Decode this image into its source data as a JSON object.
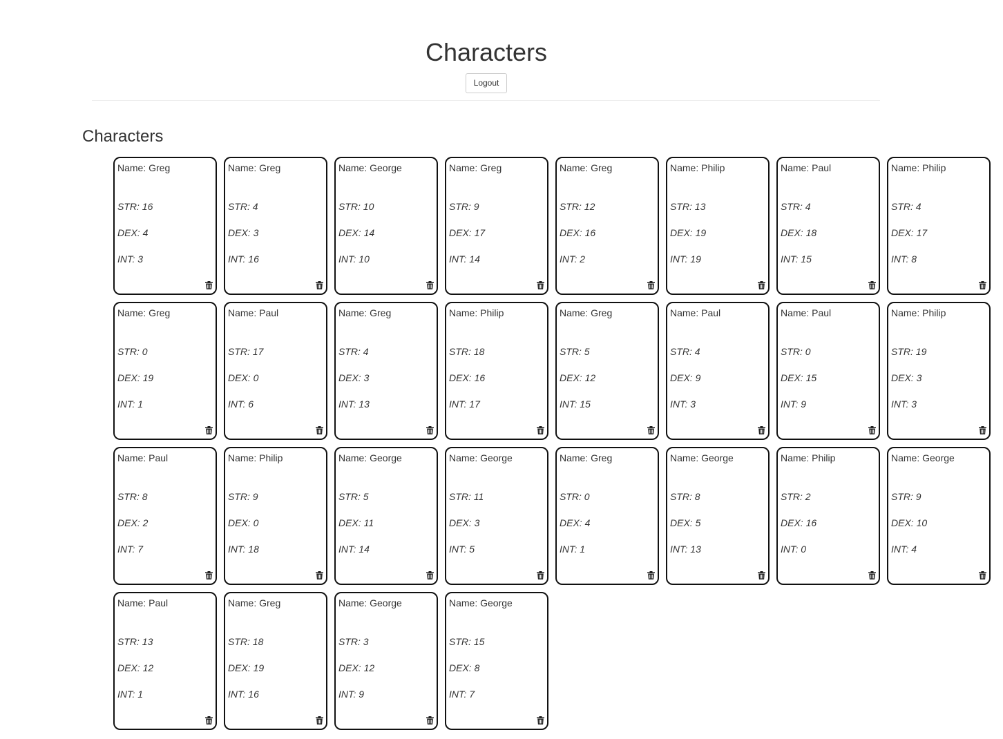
{
  "header": {
    "title": "Characters",
    "logout_label": "Logout"
  },
  "section": {
    "title": "Characters"
  },
  "labels": {
    "name": "Name: ",
    "str": "STR: ",
    "dex": "DEX: ",
    "int": "INT: "
  },
  "icons": {
    "delete": "trash-icon"
  },
  "characters": [
    {
      "name": "Greg",
      "str": 16,
      "dex": 4,
      "int": 3
    },
    {
      "name": "Greg",
      "str": 4,
      "dex": 3,
      "int": 16
    },
    {
      "name": "George",
      "str": 10,
      "dex": 14,
      "int": 10
    },
    {
      "name": "Greg",
      "str": 9,
      "dex": 17,
      "int": 14
    },
    {
      "name": "Greg",
      "str": 12,
      "dex": 16,
      "int": 2
    },
    {
      "name": "Philip",
      "str": 13,
      "dex": 19,
      "int": 19
    },
    {
      "name": "Paul",
      "str": 4,
      "dex": 18,
      "int": 15
    },
    {
      "name": "Philip",
      "str": 4,
      "dex": 17,
      "int": 8
    },
    {
      "name": "Greg",
      "str": 0,
      "dex": 19,
      "int": 1
    },
    {
      "name": "Paul",
      "str": 17,
      "dex": 0,
      "int": 6
    },
    {
      "name": "Greg",
      "str": 4,
      "dex": 3,
      "int": 13
    },
    {
      "name": "Philip",
      "str": 18,
      "dex": 16,
      "int": 17
    },
    {
      "name": "Greg",
      "str": 5,
      "dex": 12,
      "int": 15
    },
    {
      "name": "Paul",
      "str": 4,
      "dex": 9,
      "int": 3
    },
    {
      "name": "Paul",
      "str": 0,
      "dex": 15,
      "int": 9
    },
    {
      "name": "Philip",
      "str": 19,
      "dex": 3,
      "int": 3
    },
    {
      "name": "Paul",
      "str": 8,
      "dex": 2,
      "int": 7
    },
    {
      "name": "Philip",
      "str": 9,
      "dex": 0,
      "int": 18
    },
    {
      "name": "George",
      "str": 5,
      "dex": 11,
      "int": 14
    },
    {
      "name": "George",
      "str": 11,
      "dex": 3,
      "int": 5
    },
    {
      "name": "Greg",
      "str": 0,
      "dex": 4,
      "int": 1
    },
    {
      "name": "George",
      "str": 8,
      "dex": 5,
      "int": 13
    },
    {
      "name": "Philip",
      "str": 2,
      "dex": 16,
      "int": 0
    },
    {
      "name": "George",
      "str": 9,
      "dex": 10,
      "int": 4
    },
    {
      "name": "Paul",
      "str": 13,
      "dex": 12,
      "int": 1
    },
    {
      "name": "Greg",
      "str": 18,
      "dex": 19,
      "int": 16
    },
    {
      "name": "George",
      "str": 3,
      "dex": 12,
      "int": 9
    },
    {
      "name": "George",
      "str": 15,
      "dex": 8,
      "int": 7
    }
  ]
}
